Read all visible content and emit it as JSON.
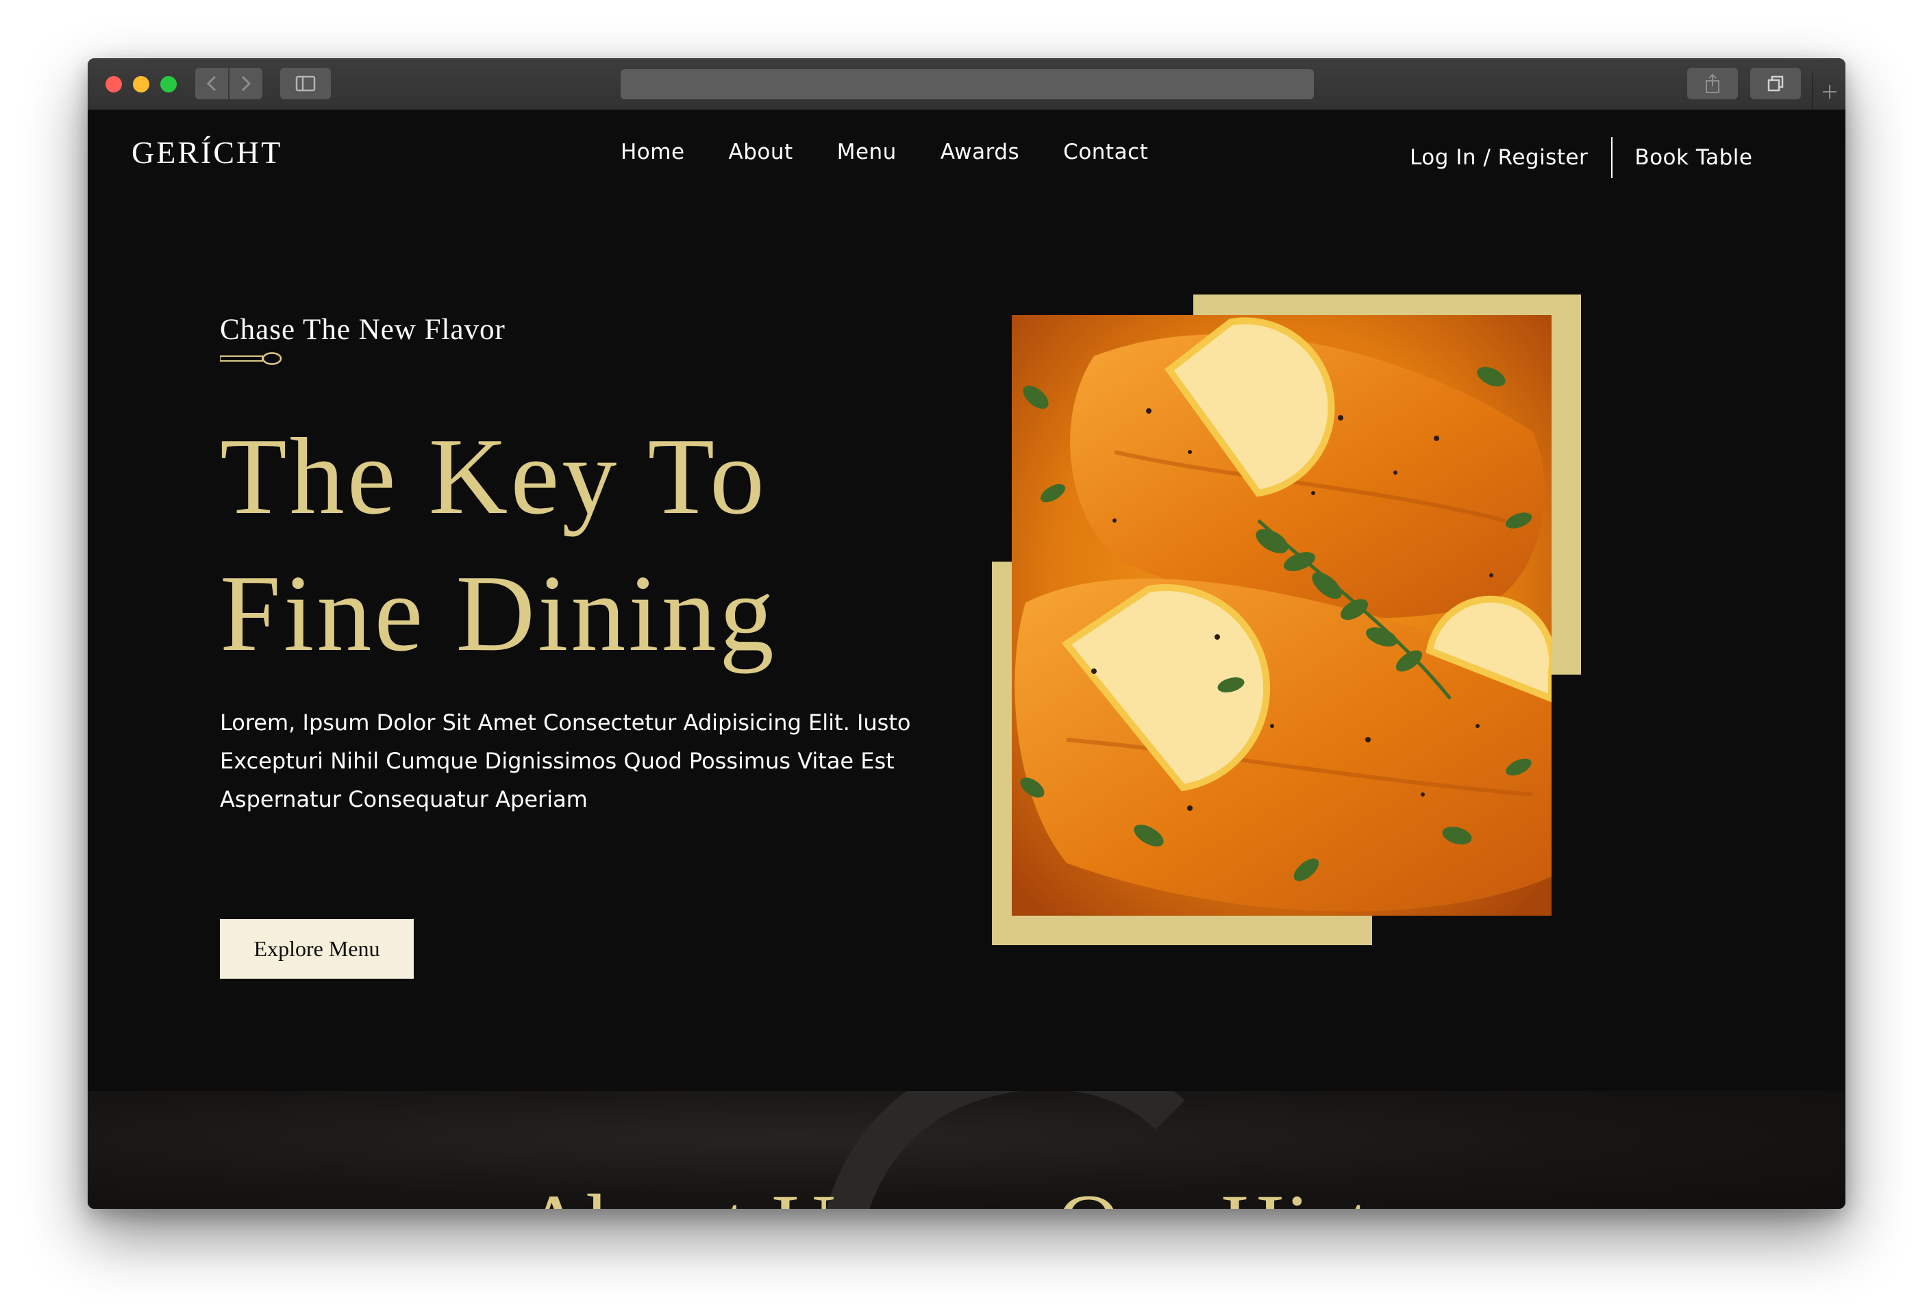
{
  "browser": {
    "back_icon": "chevron-left-icon",
    "forward_icon": "chevron-right-icon",
    "sidebar_icon": "sidebar-icon",
    "share_icon": "share-icon",
    "tabs_icon": "tabs-icon",
    "new_tab_icon": "plus-icon"
  },
  "header": {
    "logo": "GERÍCHT",
    "nav": [
      "Home",
      "About",
      "Menu",
      "Awards",
      "Contact"
    ],
    "login_label": "Log In / Register",
    "book_label": "Book Table"
  },
  "hero": {
    "subtitle": "Chase The New Flavor",
    "title_line1": "The Key To",
    "title_line2": "Fine Dining",
    "description": "Lorem, Ipsum Dolor Sit Amet Consectetur Adipisicing Elit. Iusto Excepturi Nihil Cumque Dignissimos Quod Possimus Vitae Est Aspernatur Consequatur Aperiam",
    "cta_label": "Explore Menu",
    "image_alt": "salmon-dish-image"
  },
  "sections": {
    "about_title": "About Us",
    "history_title": "Our History"
  },
  "colors": {
    "page_background": "#0c0c0c",
    "accent_gold": "#dcca87",
    "button_cream": "#f5efdb",
    "text_white": "#ffffff"
  }
}
